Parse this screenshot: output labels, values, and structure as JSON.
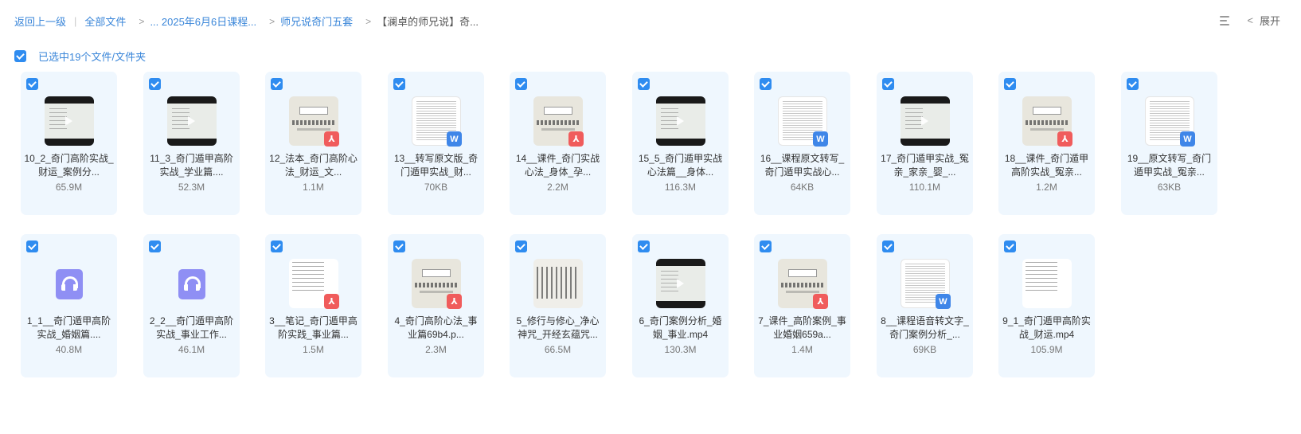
{
  "breadcrumb": {
    "back": "返回上一级",
    "separator": "|",
    "items": [
      "全部文件",
      "... 2025年6月6日课程...",
      "师兄说奇门五套"
    ],
    "current": "【澜卓的师兄说】奇...",
    "chevron": ">"
  },
  "toolbar": {
    "list_icon": "list-view-icon",
    "chevron": "<",
    "expand_label": "展开"
  },
  "selection": {
    "label": "已选中19个文件/文件夹",
    "checked": true
  },
  "colors": {
    "accent": "#2f8cf0",
    "card_bg": "#eff7fe",
    "pdf_badge": "#f05c5c",
    "word_badge": "#3f86e8",
    "audio_icon": "#8f8ff4"
  },
  "badges": {
    "pdf": "⅄",
    "word": "W"
  },
  "files": [
    {
      "name": "10_2_奇门高阶实战_财运_案例分...",
      "size": "65.9M",
      "thumb": "video",
      "badge": ""
    },
    {
      "name": "11_3_奇门遁甲高阶实战_学业篇....",
      "size": "52.3M",
      "thumb": "video",
      "badge": ""
    },
    {
      "name": "12_法本_奇门高阶心法_财运_文...",
      "size": "1.1M",
      "thumb": "slide",
      "badge": "pdf"
    },
    {
      "name": "13__转写原文版_奇门遁甲实战_财...",
      "size": "70KB",
      "thumb": "doc",
      "badge": "word"
    },
    {
      "name": "14__课件_奇门实战心法_身体_孕...",
      "size": "2.2M",
      "thumb": "slide",
      "badge": "pdf"
    },
    {
      "name": "15_5_奇门遁甲实战心法篇__身体...",
      "size": "116.3M",
      "thumb": "video",
      "badge": ""
    },
    {
      "name": "16__课程原文转写_奇门遁甲实战心...",
      "size": "64KB",
      "thumb": "doc",
      "badge": "word"
    },
    {
      "name": "17_奇门遁甲实战_冤亲_家亲_婴_...",
      "size": "110.1M",
      "thumb": "video",
      "badge": ""
    },
    {
      "name": "18__课件_奇门遁甲高阶实战_冤亲...",
      "size": "1.2M",
      "thumb": "slide",
      "badge": "pdf"
    },
    {
      "name": "19__原文转写_奇门遁甲实战_冤亲...",
      "size": "63KB",
      "thumb": "doc",
      "badge": "word"
    },
    {
      "name": "1_1__奇门遁甲高阶实战_婚姻篇....",
      "size": "40.8M",
      "thumb": "audio",
      "badge": ""
    },
    {
      "name": "2_2__奇门遁甲高阶实战_事业工作...",
      "size": "46.1M",
      "thumb": "audio",
      "badge": ""
    },
    {
      "name": "3__笔记_奇门遁甲高阶实践_事业篇...",
      "size": "1.5M",
      "thumb": "note",
      "badge": "pdf"
    },
    {
      "name": "4_奇门高阶心法_事业篇69b4.p...",
      "size": "2.3M",
      "thumb": "slide",
      "badge": "pdf"
    },
    {
      "name": "5_修行与修心_净心神咒_开经玄蕴咒...",
      "size": "66.5M",
      "thumb": "dots",
      "badge": ""
    },
    {
      "name": "6_奇门案例分析_婚姻_事业.mp4",
      "size": "130.3M",
      "thumb": "video",
      "badge": ""
    },
    {
      "name": "7_课件_高阶案例_事业婚姻659a...",
      "size": "1.4M",
      "thumb": "slide",
      "badge": "pdf"
    },
    {
      "name": "8__课程语音转文字_奇门案例分析_...",
      "size": "69KB",
      "thumb": "doc",
      "badge": "word"
    },
    {
      "name": "9_1_奇门遁甲高阶实战_财运.mp4",
      "size": "105.9M",
      "thumb": "note",
      "badge": ""
    }
  ]
}
